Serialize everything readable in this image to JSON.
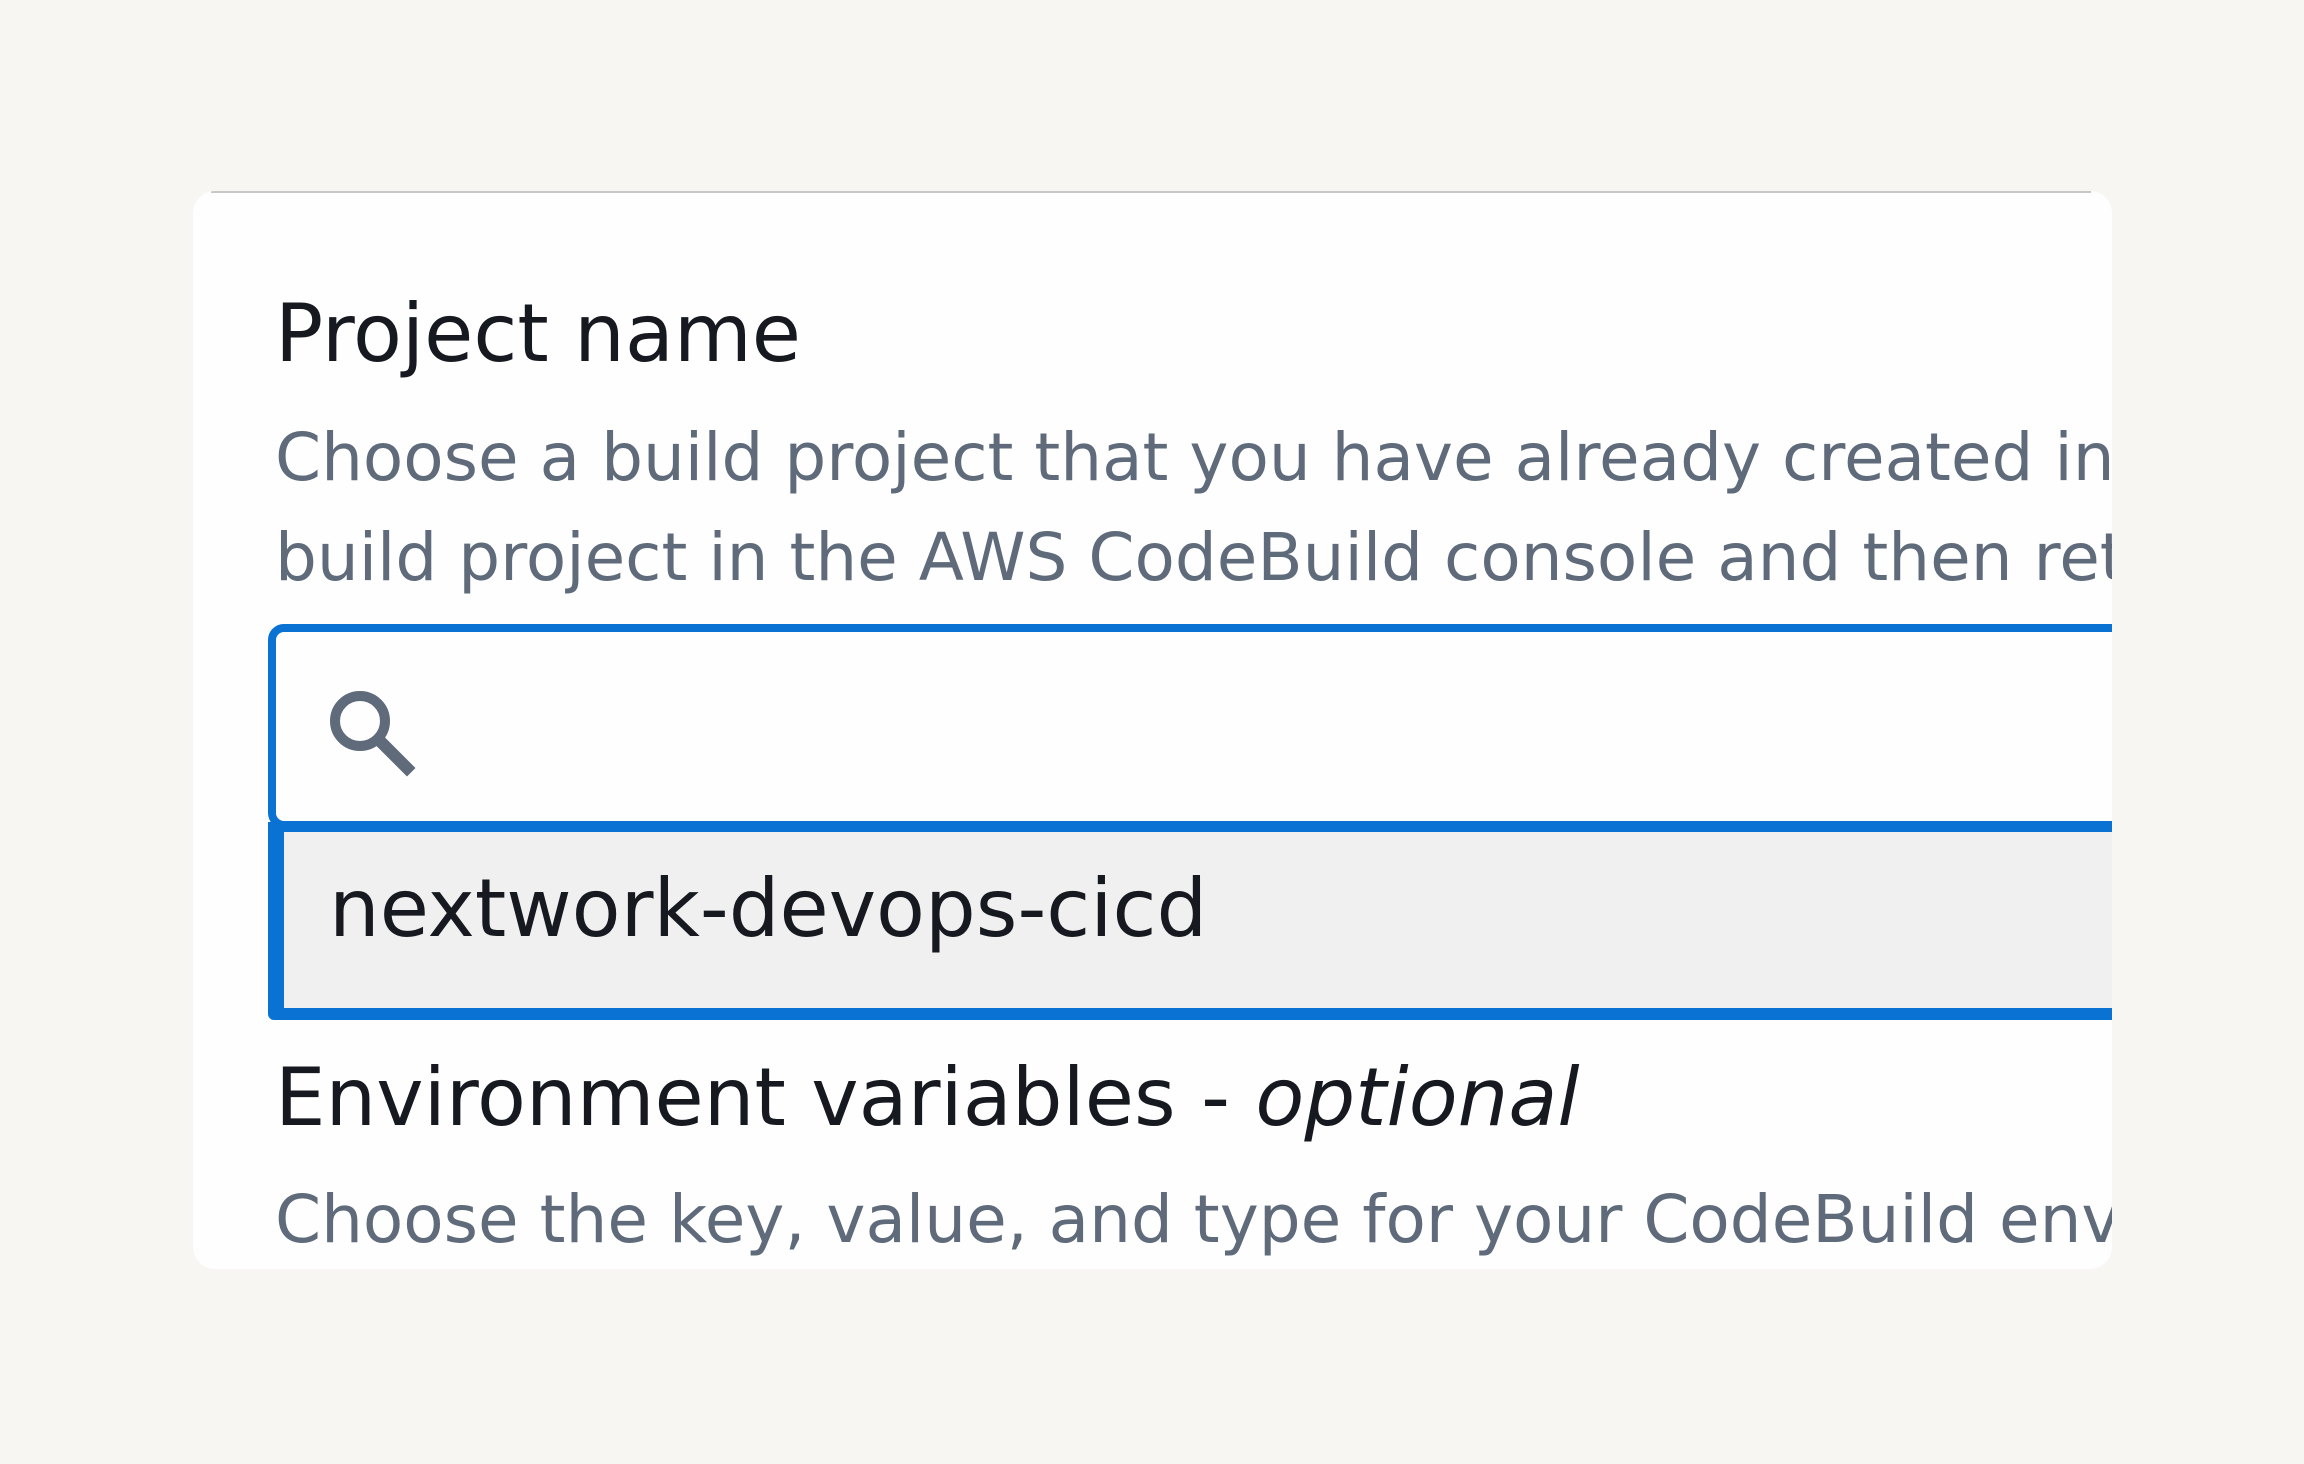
{
  "colors": {
    "page_background": "#f8f6f2",
    "card_background": "#fefefe",
    "accent": "#0972d3",
    "heading_text": "#16191f",
    "description_text": "#5f6b7a",
    "dropdown_item_background": "#f0f0f0"
  },
  "form": {
    "project_name": {
      "label": "Project name",
      "description_lines": [
        "Choose a build project that you have already created in the AWS CodeBuild console or create a",
        "build project in the AWS CodeBuild console and then return to this task."
      ]
    },
    "search": {
      "icon": "search-icon",
      "placeholder": "",
      "value": "",
      "clear_icon": "clear-icon"
    },
    "dropdown": {
      "options": [
        {
          "label": "nextwork-devops-cicd"
        }
      ]
    },
    "environment_variables": {
      "label": "Environment variables - ",
      "optional_label": "optional",
      "description": "Choose the key, value, and type for your CodeBuild environment variables."
    }
  }
}
